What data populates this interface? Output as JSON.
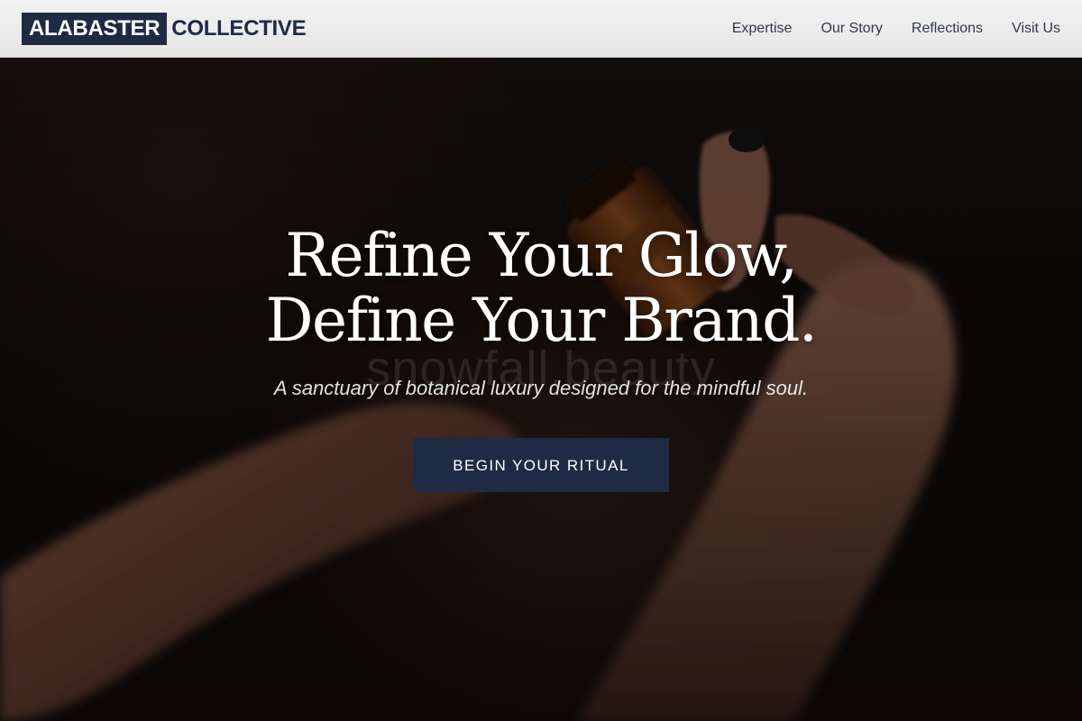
{
  "brand": {
    "logo_highlight": "ALABASTER",
    "logo_rest": "COLLECTIVE",
    "accent_color": "#1f2a44"
  },
  "nav": {
    "items": [
      {
        "label": "Expertise"
      },
      {
        "label": "Our Story"
      },
      {
        "label": "Reflections"
      },
      {
        "label": "Visit Us"
      }
    ]
  },
  "hero": {
    "headline_line1": "Refine Your Glow,",
    "headline_line2": "Define Your Brand.",
    "watermark": "snowfall.beauty",
    "tagline": "A sanctuary of botanical luxury designed for the mindful soul.",
    "cta_label": "BEGIN YOUR RITUAL"
  }
}
